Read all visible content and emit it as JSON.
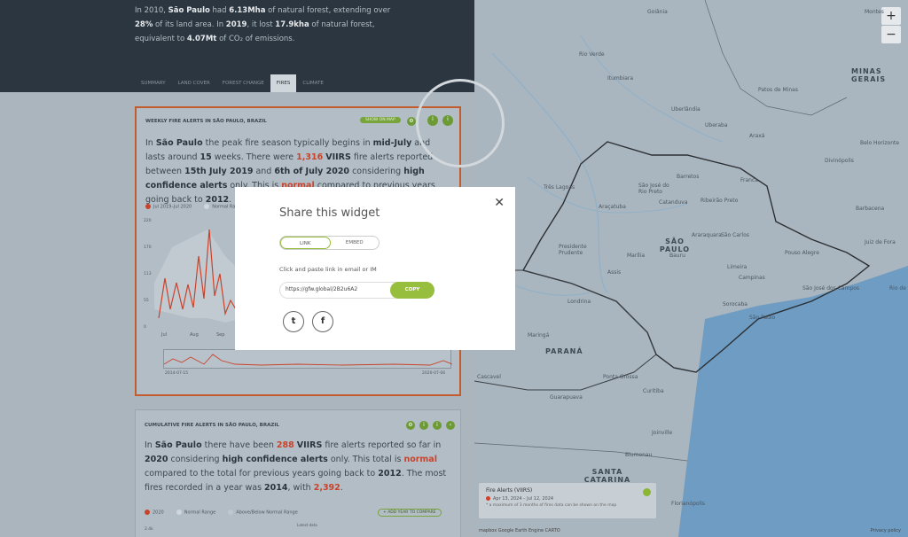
{
  "header": {
    "intro": {
      "p1": "In 2010, ",
      "region": "São Paulo",
      "p2": " had ",
      "forest_area": "6.13Mha",
      "p3": " of natural forest, extending over ",
      "pct": "28%",
      "p4": " of its land area. In ",
      "year": "2019",
      "p5": ", it lost ",
      "loss": "17.9kha",
      "p6": " of natural forest, equivalent to ",
      "emissions": "4.07Mt",
      "p7": " of CO₂ of emissions."
    },
    "tabs": [
      "SUMMARY",
      "LAND COVER",
      "FOREST CHANGE",
      "FIRES",
      "CLIMATE"
    ],
    "active_tab": 3
  },
  "widget1": {
    "title": "WEEKLY FIRE ALERTS IN SÃO PAULO, BRAZIL",
    "show_on_map": "SHOW ON MAP",
    "text": {
      "t1": "In ",
      "region": "São Paulo",
      "t2": " the peak fire season typically begins in ",
      "start": "mid-July",
      "t3": " and lasts around ",
      "weeks": "15",
      "t4": " weeks. There were ",
      "count": "1,316",
      "t5": " ",
      "viirs": "VIIRS",
      "t6": " fire alerts reported between ",
      "d1": "15th July 2019",
      "t7": " and ",
      "d2": "6th of July 2020",
      "t8": " considering ",
      "conf": "high confidence alerts",
      "t9": " only. This is ",
      "status": "normal",
      "t10": " compared to previous years going back to ",
      "since": "2012",
      "t11": "."
    },
    "legend": [
      "Jul 2019–Jul 2020",
      "Normal Range"
    ],
    "yticks": [
      "220",
      "170",
      "113",
      "55",
      "0"
    ],
    "xticks": [
      "Jul",
      "Aug",
      "Sep"
    ],
    "range_start": "2014-07-15",
    "range_end": "2020-07-06"
  },
  "widget2": {
    "title": "CUMULATIVE FIRE ALERTS IN SÃO PAULO, BRAZIL",
    "text": {
      "t1": "In ",
      "region": "São Paulo",
      "t2": " there have been ",
      "count": "288",
      "t3": " ",
      "viirs": "VIIRS",
      "t4": " fire alerts reported so far in ",
      "year": "2020",
      "t5": " considering ",
      "conf": "high confidence alerts",
      "t6": " only. This total is ",
      "status": "normal",
      "t7": " compared to the total for previous years going back to ",
      "since": "2012",
      "t8": ". The most fires recorded in a year was ",
      "maxyear": "2014",
      "t9": ", with ",
      "maxval": "2,392",
      "t10": "."
    },
    "legend": [
      "2020",
      "Normal Range",
      "Above/Below Normal Range"
    ],
    "add_year": "+ ADD YEAR TO COMPARE",
    "latest": "Latest data",
    "ytick": "2.4k"
  },
  "modal": {
    "title": "Share this widget",
    "close": "✕",
    "tab_link": "LINK",
    "tab_embed": "EMBED",
    "hint": "Click and paste link in email or IM",
    "url": "https://gfw.global/2B2u6A2",
    "copy": "COPY",
    "twitter": "t",
    "facebook": "f"
  },
  "map": {
    "zoom_in": "+",
    "zoom_out": "−",
    "labels": {
      "montes": "Montes",
      "goiania": "Goiânia",
      "rioverde": "Rio Verde",
      "minas": "MINAS GERAIS",
      "uberlandia": "Uberlândia",
      "uberaba": "Uberaba",
      "araxa": "Araxá",
      "patos": "Patos de Minas",
      "divinopolis": "Divinópolis",
      "bhorizonte": "Belo Horizonte",
      "itumbiara": "Itumbiara",
      "treslagoas": "Três Lagoas",
      "sjrp": "São José do Rio Preto",
      "barretos": "Barretos",
      "franca": "Franca",
      "ribeirao": "Ribeirão Preto",
      "aracatuba": "Araçatuba",
      "catanduva": "Catanduva",
      "saopaulo_state": "SÃO PAULO",
      "araraquara": "Araraquara",
      "sao_carlos": "São Carlos",
      "poupres": "Presidente Prudente",
      "marilia": "Marília",
      "bauru": "Bauru",
      "assis": "Assis",
      "limeira": "Limeira",
      "campinas": "Campinas",
      "pouso": "Pouso Alegre",
      "sjcampos": "São José dos Campos",
      "sorocaba": "Sorocaba",
      "sp_city": "São Paulo",
      "londrina": "Londrina",
      "maringa": "Maringá",
      "parana": "PARANÁ",
      "pgrossa": "Ponta Grossa",
      "curitiba": "Curitiba",
      "guarapuava": "Guarapuava",
      "cascavel": "Cascavel",
      "joinville": "Joinville",
      "blumenau": "Blumenau",
      "santacat": "SANTA CATARINA",
      "florianopolis": "Florianópolis",
      "juiz": "Juiz de Fora",
      "barbacena": "Barbacena",
      "riodej": "Rio de"
    },
    "legend": {
      "title": "Fire Alerts (VIIRS)",
      "dates": "Apr 13, 2024 – Jul 12, 2024",
      "note": "* a maximum of 3 months of fires data can be shown on the map"
    },
    "attribution_left": "mapbox  Google Earth Engine  CARTO",
    "attribution_right": "Privacy policy"
  }
}
